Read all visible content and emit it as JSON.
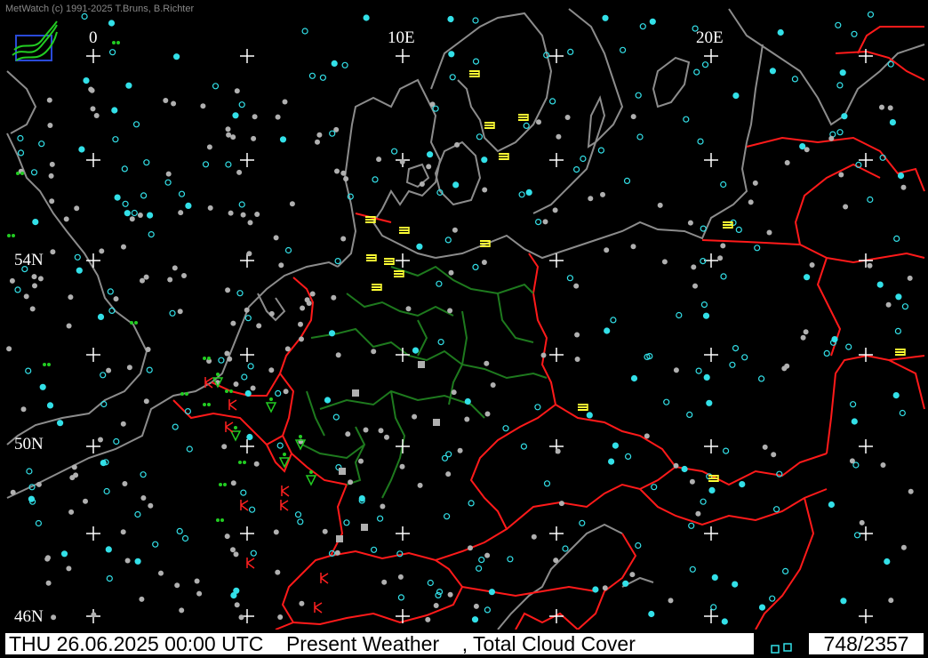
{
  "app": {
    "credit": "MetWatch  (c) 1991-2025 T.Bruns, B.Richter"
  },
  "grid": {
    "lon_labels": [
      "0",
      "10E",
      "20E"
    ],
    "lat_labels": [
      "54N",
      "50N",
      "46N"
    ]
  },
  "status": {
    "datetime": "THU 26.06.2025 00:00 UTC",
    "product": "Present Weather",
    "secondary": ", Total Cloud Cover",
    "count": "748/2357"
  },
  "colors": {
    "background": "#000000",
    "coastline": "#8c8c8c",
    "border_country": "#ff1a1a",
    "border_state": "#1e7a1e",
    "cloud_station": "#33e0e8",
    "cloud_station_grey": "#b0b0b0",
    "weather_yellow": "#ffff33",
    "weather_green": "#22cc22",
    "weather_red": "#ff2020",
    "grid_cross": "#ffffff"
  },
  "icons": [
    "metwatch-logo-icon",
    "grid-cross-icon",
    "station-circle-icon",
    "fog-symbol-icon",
    "drizzle-symbol-icon",
    "thunderstorm-symbol-icon",
    "shower-symbol-icon"
  ]
}
